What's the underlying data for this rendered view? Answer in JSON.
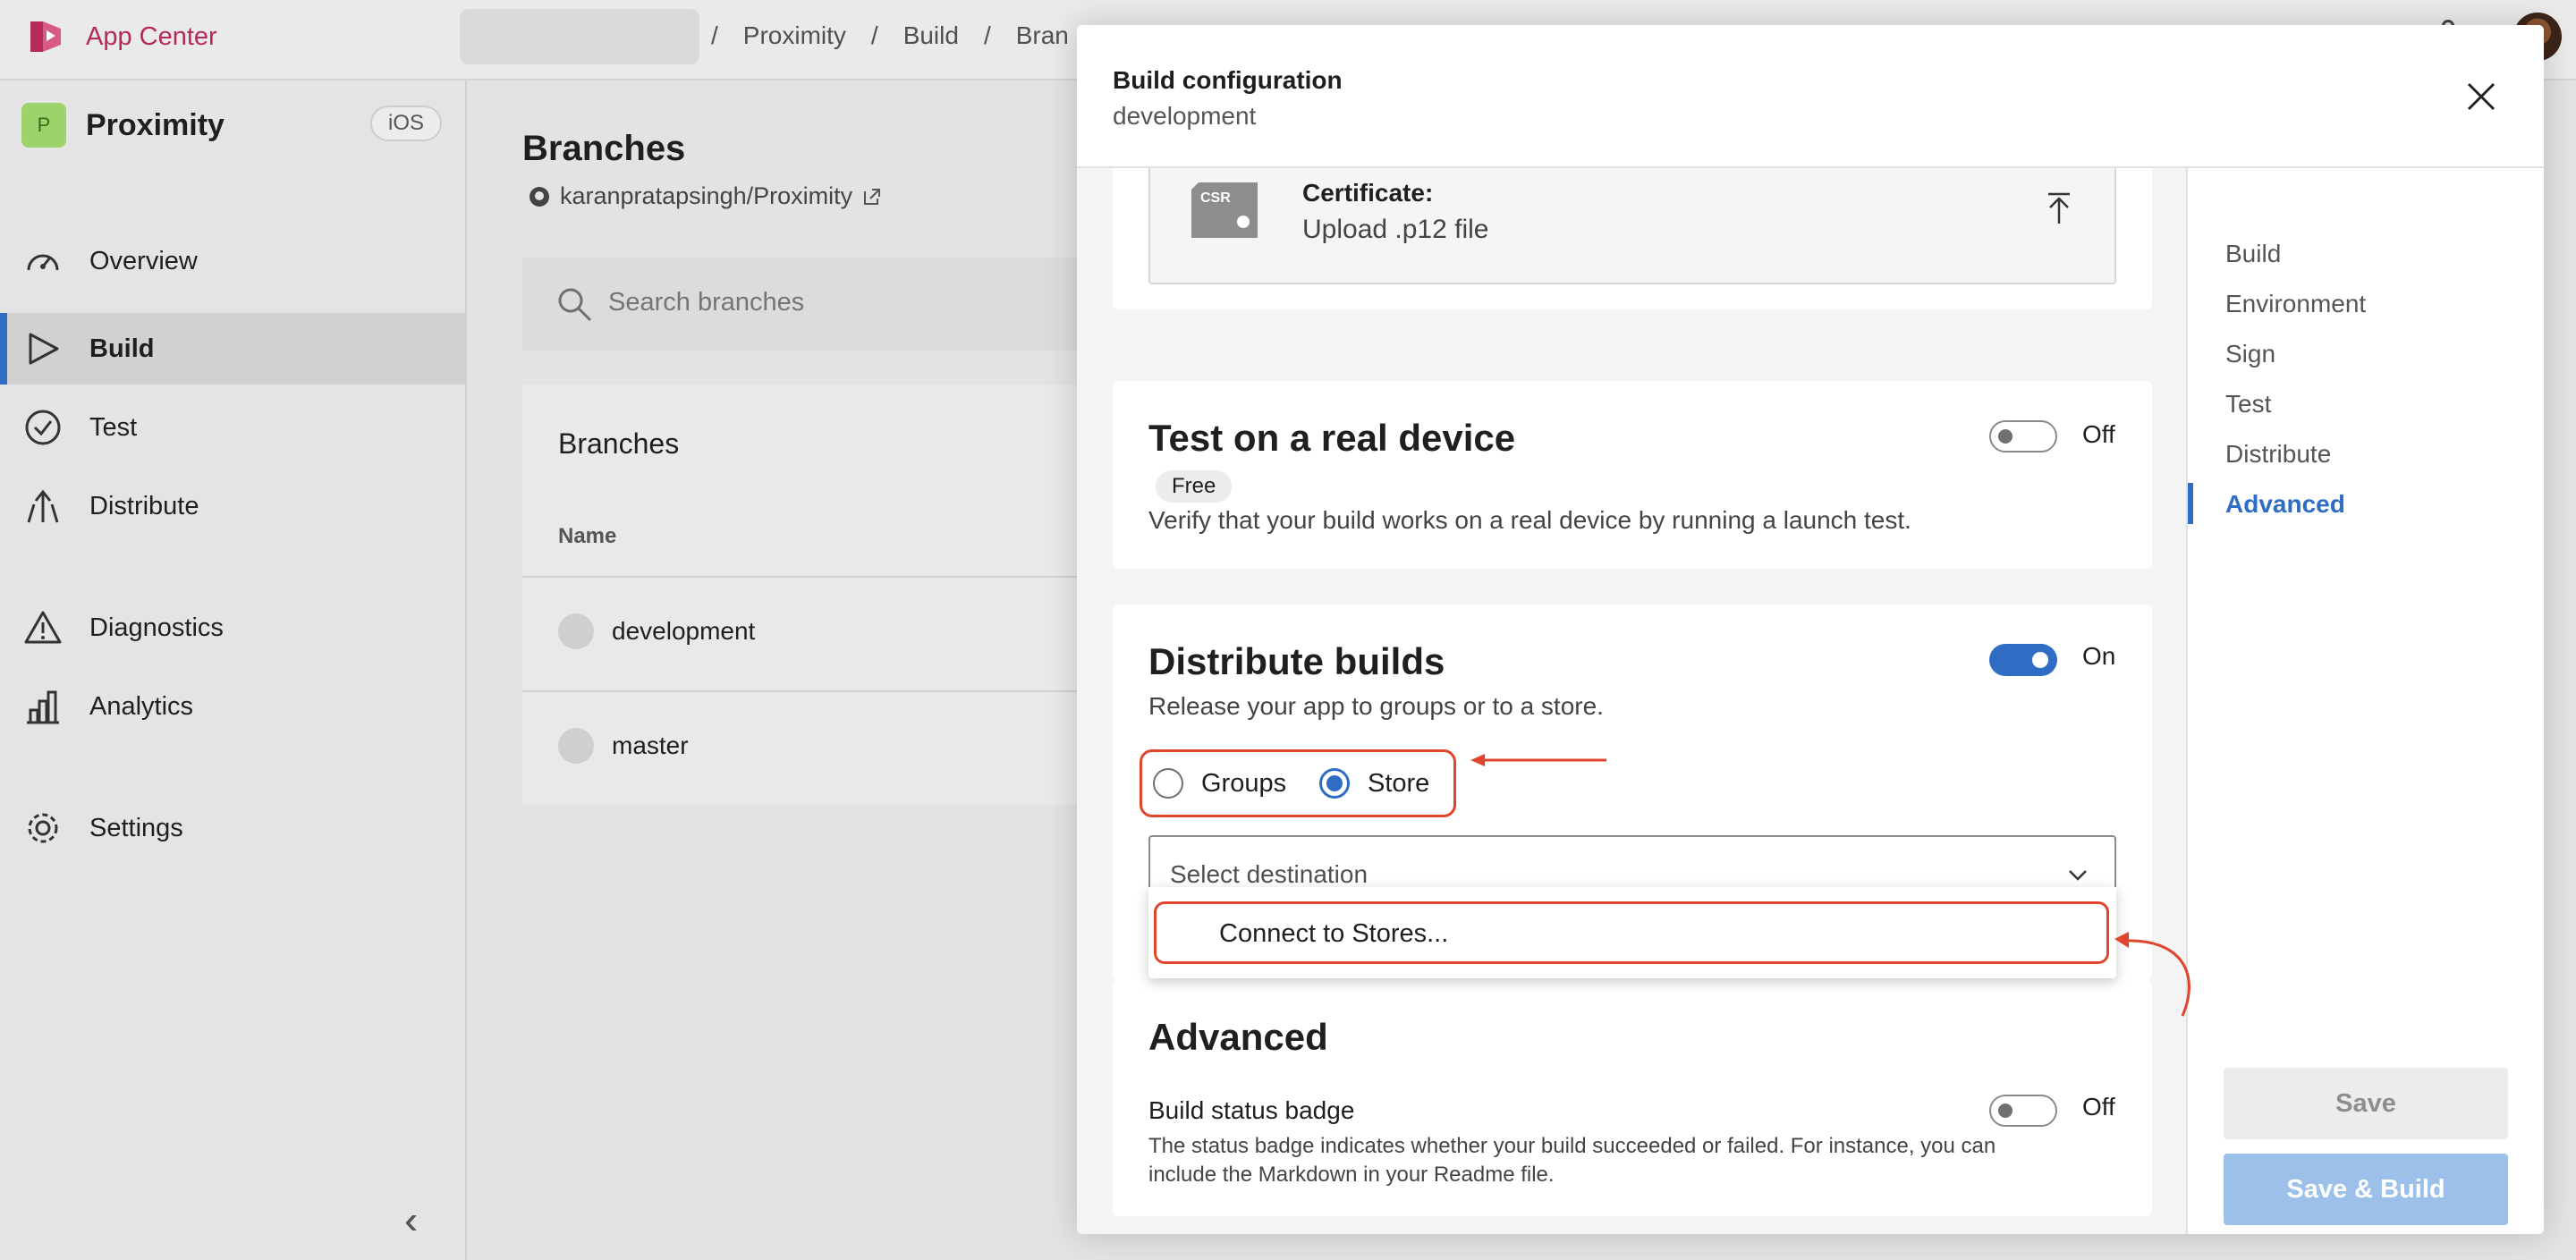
{
  "app": {
    "brand_name": "App Center",
    "brand_color": "#b52a5a",
    "accent_color": "#2f6dc4",
    "highlight_color": "#e0442c"
  },
  "breadcrumbs": [
    {
      "label": "Proximity"
    },
    {
      "label": "Build"
    },
    {
      "label": "Bran"
    }
  ],
  "sidebar": {
    "app_name": "Proximity",
    "app_initial": "P",
    "platform": "iOS",
    "items": [
      {
        "label": "Overview",
        "icon": "gauge-icon"
      },
      {
        "label": "Build",
        "icon": "play-icon",
        "active": true
      },
      {
        "label": "Test",
        "icon": "check-circle-icon"
      },
      {
        "label": "Distribute",
        "icon": "distribute-icon"
      },
      {
        "label": "Diagnostics",
        "icon": "warning-icon"
      },
      {
        "label": "Analytics",
        "icon": "bar-chart-icon"
      },
      {
        "label": "Settings",
        "icon": "gear-icon"
      }
    ]
  },
  "main": {
    "title": "Branches",
    "repo": "karanpratapsingh/Proximity",
    "search_placeholder": "Search branches",
    "card_title": "Branches",
    "column_name": "Name",
    "branches": [
      {
        "name": "development"
      },
      {
        "name": "master"
      }
    ]
  },
  "panel": {
    "title": "Build configuration",
    "subtitle": "development",
    "certificate": {
      "label": "Certificate:",
      "value": "Upload .p12 file",
      "icon_text": "CSR"
    },
    "test_device": {
      "title": "Test on a real device",
      "pill": "Free",
      "description": "Verify that your build works on a real device by running a launch test.",
      "toggle_label": "Off",
      "enabled": false
    },
    "distribute": {
      "title": "Distribute builds",
      "description": "Release your app to groups or to a store.",
      "toggle_label": "On",
      "enabled": true,
      "options": [
        {
          "label": "Groups",
          "selected": false
        },
        {
          "label": "Store",
          "selected": true
        }
      ],
      "select_placeholder": "Select destination",
      "dropdown_options": [
        "Connect to Stores..."
      ]
    },
    "advanced": {
      "title": "Advanced",
      "badge_title": "Build status badge",
      "badge_description": "The status badge indicates whether your build succeeded or failed. For instance, you can include the Markdown in your Readme file.",
      "toggle_label": "Off",
      "enabled": false
    },
    "nav": [
      {
        "label": "Build"
      },
      {
        "label": "Environment"
      },
      {
        "label": "Sign"
      },
      {
        "label": "Test"
      },
      {
        "label": "Distribute"
      },
      {
        "label": "Advanced",
        "active": true
      }
    ],
    "buttons": {
      "save": "Save",
      "save_build": "Save & Build"
    }
  }
}
